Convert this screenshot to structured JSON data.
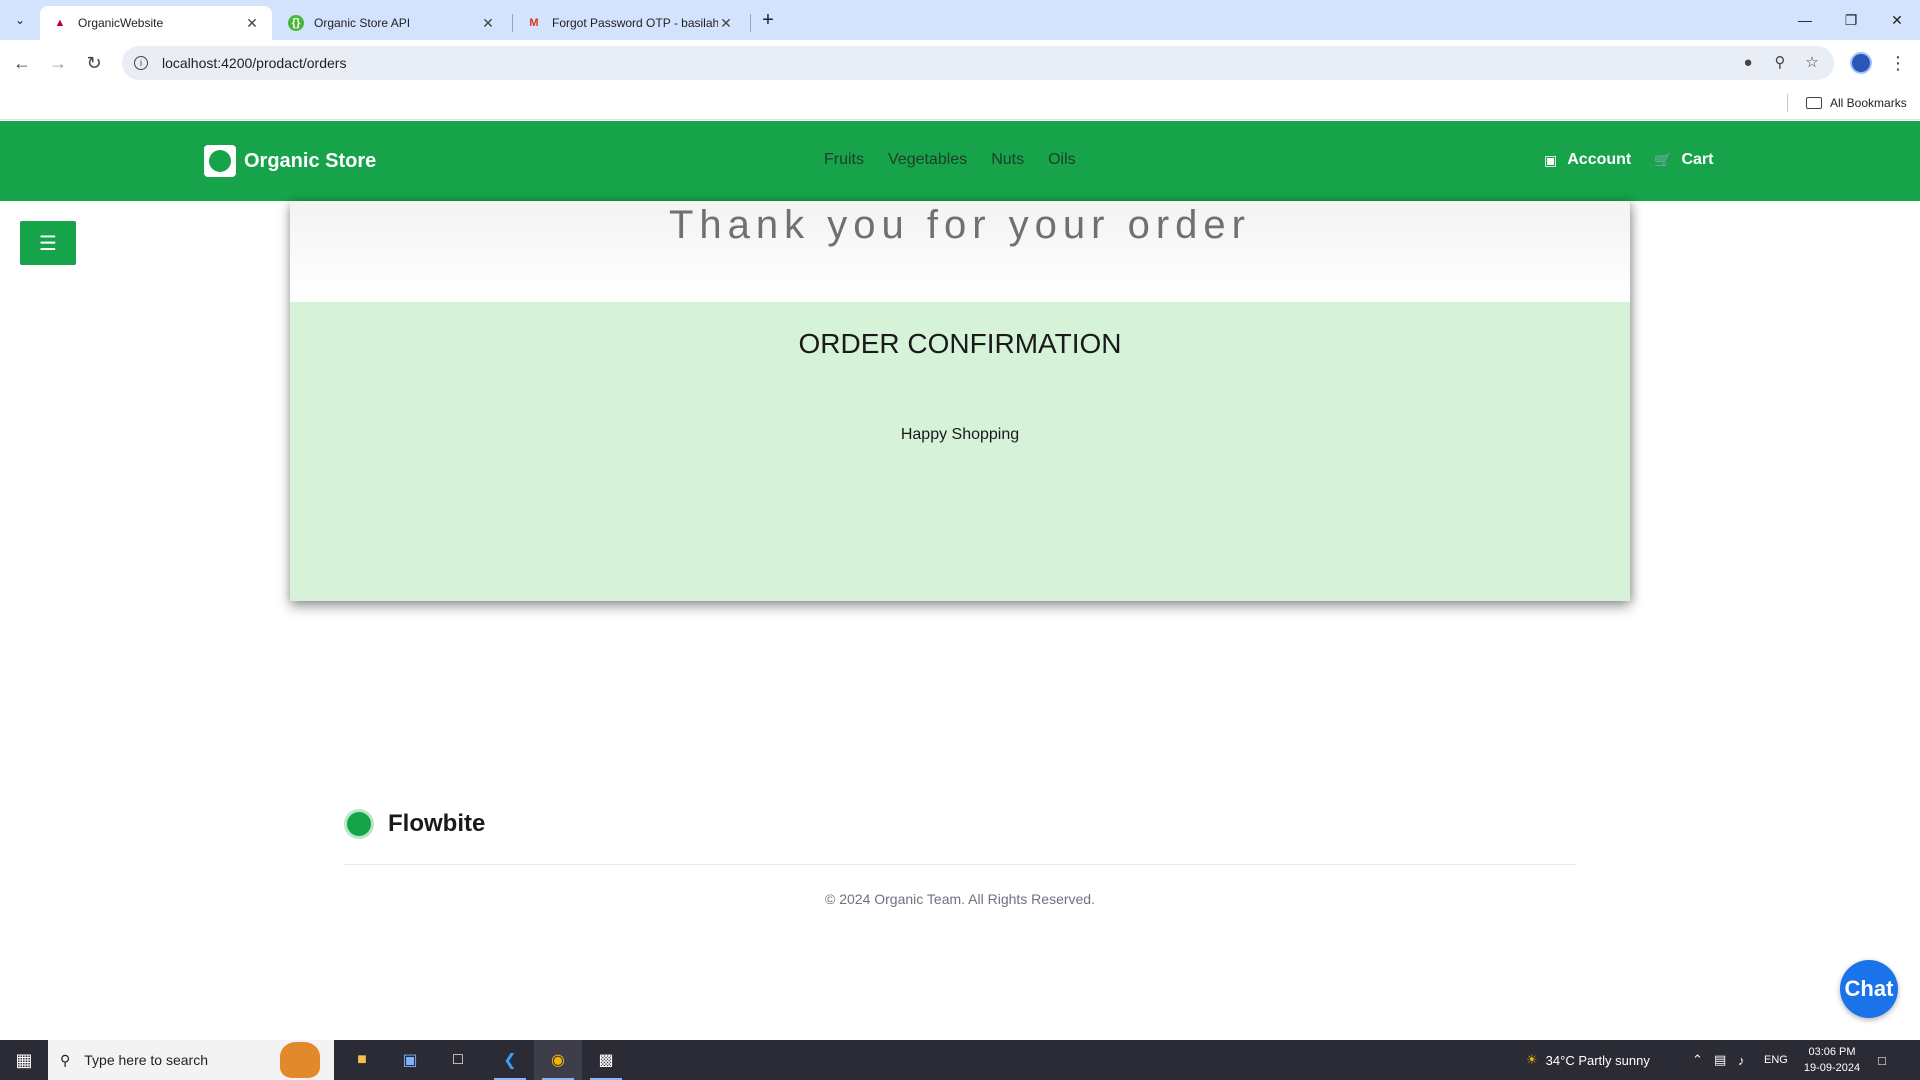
{
  "browser": {
    "tabs": [
      {
        "title": "OrganicWebsite",
        "favicon": "angular-icon",
        "active": true
      },
      {
        "title": "Organic Store API",
        "favicon": "swagger-icon",
        "active": false
      },
      {
        "title": "Forgot Password OTP - basilaha",
        "favicon": "gmail-icon",
        "active": false
      }
    ],
    "url": "localhost:4200/prodact/orders",
    "bookmarks_label": "All Bookmarks"
  },
  "site": {
    "brand": "Organic Store",
    "nav": [
      "Fruits",
      "Vegetables",
      "Nuts",
      "Oils"
    ],
    "account_label": "Account",
    "cart_label": "Cart",
    "accent_color": "#16a34a"
  },
  "order": {
    "thanks": "Thank you for your order",
    "heading": "ORDER CONFIRMATION",
    "message": "Happy Shopping"
  },
  "footer": {
    "brand": "Flowbite",
    "copyright": "© 2024 Organic Team. All Rights Reserved."
  },
  "chat": {
    "label": "Chat"
  },
  "taskbar": {
    "search_placeholder": "Type here to search",
    "weather": "34°C  Partly sunny",
    "language": "ENG",
    "time": "03:06 PM",
    "date": "19-09-2024"
  }
}
